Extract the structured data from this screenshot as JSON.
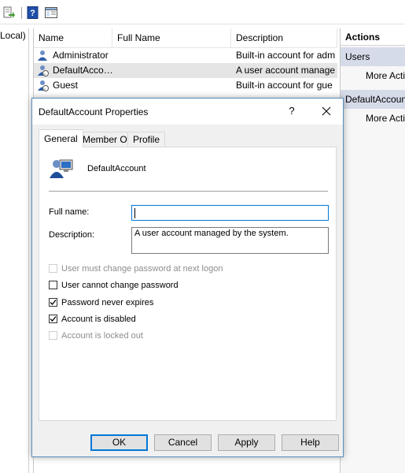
{
  "toolbar": {
    "icons": [
      "export-list-icon",
      "help-icon",
      "mmc-show-hide-icon"
    ]
  },
  "tree": {
    "node_label": "Local)"
  },
  "list": {
    "columns": [
      "Name",
      "Full Name",
      "Description"
    ],
    "rows": [
      {
        "name": "Administrator",
        "full_name": "",
        "description": "Built-in account for adm"
      },
      {
        "name": "DefaultAcco…",
        "full_name": "",
        "description": "A user account manage"
      },
      {
        "name": "Guest",
        "full_name": "",
        "description": "Built-in account for gue"
      }
    ],
    "selected_index": 1
  },
  "actions": {
    "header": "Actions",
    "sections": [
      {
        "label": "Users",
        "item": "More Acti"
      },
      {
        "label": "DefaultAccoun",
        "item": "More Acti"
      }
    ]
  },
  "dialog": {
    "title": "DefaultAccount Properties",
    "help_label": "?",
    "tabs": [
      "General",
      "Member Of",
      "Profile"
    ],
    "active_tab": 0,
    "account_name": "DefaultAccount",
    "full_name_label": "Full name:",
    "full_name_value": "",
    "description_label": "Description:",
    "description_value": "A user account managed by the system.",
    "checkboxes": [
      {
        "label": "User must change password at next logon",
        "checked": false,
        "disabled": true
      },
      {
        "label": "User cannot change password",
        "checked": false,
        "disabled": false
      },
      {
        "label": "Password never expires",
        "checked": true,
        "disabled": false
      },
      {
        "label": "Account is disabled",
        "checked": true,
        "disabled": false
      },
      {
        "label": "Account is locked out",
        "checked": false,
        "disabled": true
      }
    ],
    "buttons": {
      "ok": "OK",
      "cancel": "Cancel",
      "apply": "Apply",
      "help": "Help"
    }
  },
  "colors": {
    "accent": "#0078d7",
    "selection": "#e5e5e5",
    "actions_section": "#d6dbe9"
  }
}
